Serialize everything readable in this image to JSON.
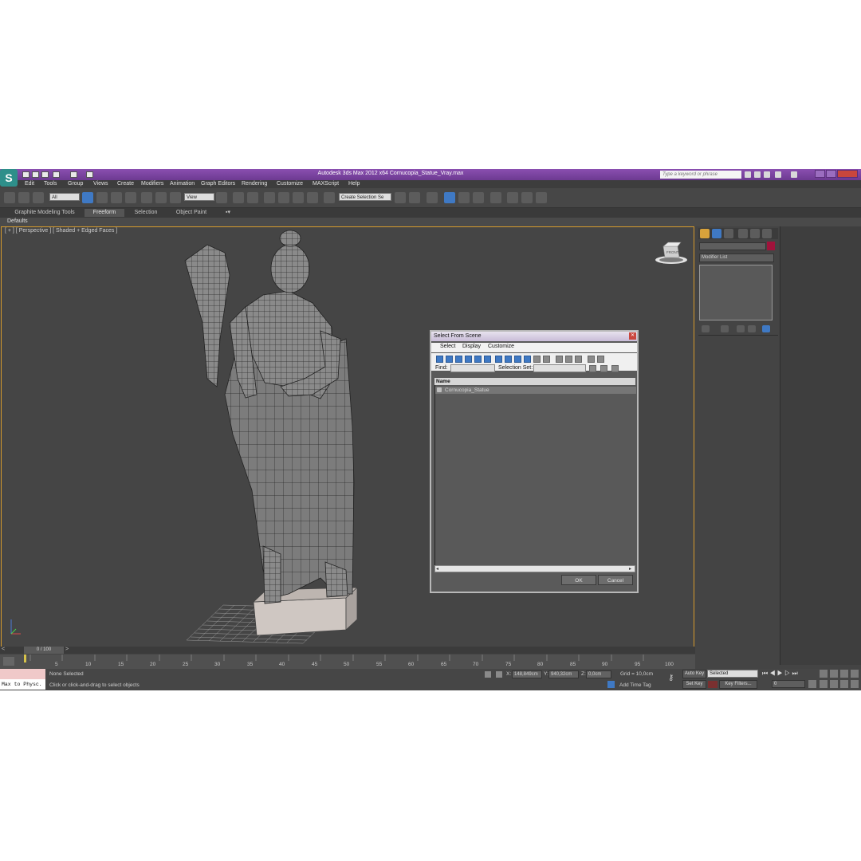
{
  "titlebar": {
    "title": "Autodesk 3ds Max  2012 x64       Cornucopia_Statue_Vray.max",
    "search_placeholder": "Type a keyword or phrase"
  },
  "menu": [
    "Edit",
    "Tools",
    "Group",
    "Views",
    "Create",
    "Modifiers",
    "Animation",
    "Graph Editors",
    "Rendering",
    "Customize",
    "MAXScript",
    "Help"
  ],
  "toolbar": {
    "filter_value": "All",
    "coord_value": "View",
    "selection_set_value": "Create Selection Se"
  },
  "ribbon": {
    "tabs": [
      "Graphite Modeling Tools",
      "Freeform",
      "Selection",
      "Object Paint"
    ],
    "active_tab": 1,
    "defaults_label": "Defaults"
  },
  "viewport": {
    "label": "[ + ] [ Perspective ] [ Shaded + Edged Faces ]",
    "cube_label": "FRONT"
  },
  "command_panel": {
    "modifier_list_label": "Modifier List",
    "object_color": "#a0133b"
  },
  "dialog": {
    "title": "Select From Scene",
    "menu": [
      "Select",
      "Display",
      "Customize"
    ],
    "find_label": "Find:",
    "selection_set_label": "Selection Set:",
    "column_name": "Name",
    "rows": [
      "Cornucopia_Statue"
    ],
    "ok_label": "OK",
    "cancel_label": "Cancel"
  },
  "timeline": {
    "frame_readout": "0 / 100",
    "ticks": [
      "5",
      "10",
      "15",
      "20",
      "25",
      "30",
      "35",
      "40",
      "45",
      "50",
      "55",
      "60",
      "65",
      "70",
      "75",
      "80",
      "85",
      "90",
      "95",
      "100"
    ]
  },
  "status": {
    "maxscript_text": "Max to Physc.",
    "selection_text": "None Selected",
    "prompt_text": "Click or click-and-drag to select objects",
    "x_label": "X:",
    "x_value": "148,849cm",
    "y_label": "Y:",
    "y_value": "940,32cm",
    "z_label": "Z:",
    "z_value": "0,0cm",
    "grid_text": "Grid = 10,0cm",
    "auto_key": "Auto Key",
    "selected_value": "Selected",
    "set_key": "Set Key",
    "key_filters": "Key Filters...",
    "add_time_tag": "Add Time Tag",
    "frame_value": "0"
  },
  "colors": {
    "accent_purple": "#7a44a0",
    "viewport_border": "#d79b2c",
    "selection_blue": "#3f79c4"
  }
}
